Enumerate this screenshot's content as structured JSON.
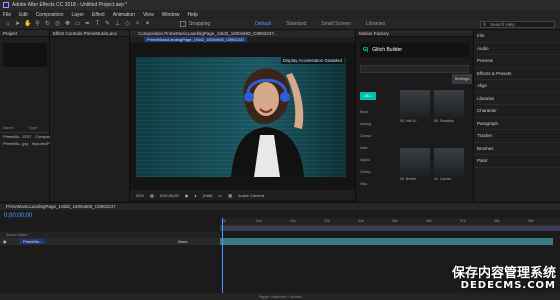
{
  "window": {
    "title": "Adobe After Effects CC 2018 - Untitled Project.aep *"
  },
  "menu": [
    "File",
    "Edit",
    "Composition",
    "Layer",
    "Effect",
    "Animation",
    "View",
    "Window",
    "Help"
  ],
  "toolbar": {
    "snapping": "Snapping",
    "workspaces": [
      "Default",
      "Standard",
      "Small Screen",
      "Libraries"
    ],
    "search_placeholder": "Search Help"
  },
  "project": {
    "tab": "Project",
    "columns": [
      "Name",
      "Type",
      "Size"
    ],
    "rows": [
      {
        "name": "PrimeMu...3707",
        "type": "Composition",
        "size": ""
      },
      {
        "name": "PrimeMu...jpg",
        "type": "ImporteJPG",
        "size": "2.5 KB"
      }
    ]
  },
  "effects_controls": {
    "tab": "Effect Controls PrimeMusicLanc"
  },
  "composition": {
    "tab": "Composition PrimeMusicLandingPage_1Sld2_1600x600_C8902247...",
    "sub_tab": "PrimeMusicLandingPage_1Sld2_1600x600_C8902247",
    "notice": "Display Acceleration Disabled",
    "zoom": "53%",
    "timecode": "0;00;00;00",
    "resolution": "(Half)",
    "camera": "Active Camera"
  },
  "motion_factory": {
    "tab": "Motion Factory",
    "product": "Glitch Builder",
    "all_label": "ALL",
    "categories": [
      "Basic",
      "Analog",
      "Classic",
      "Data",
      "Digital",
      "Glossy",
      "Misc"
    ],
    "presets": [
      "05. Hell N...",
      "06. Paradise",
      "09. Breath",
      "10. Carries"
    ],
    "settings_label": "Settings"
  },
  "right_panel": {
    "items": [
      "Info",
      "Audio",
      "Preview",
      "Effects & Presets",
      "Align",
      "Libraries",
      "Character",
      "Paragraph",
      "Tracker",
      "Brushes",
      "Paint"
    ]
  },
  "timeline": {
    "tab": "PrimeMusicLandingPage_1Sld2_1600x600_C8902247",
    "timecode": "0;00;00;00",
    "layer_header": "Source Name",
    "layer_name": "PrimeMu...",
    "mode": "None",
    "ruler_labels": [
      "0s",
      "01s",
      "02s",
      "03s",
      "04s",
      "05s",
      "06s",
      "07s",
      "08s",
      "09s"
    ],
    "footer": "Toggle Switches / Modes"
  },
  "watermark": {
    "line1": "保存内容管理系统",
    "line2": "DEDECMS.COM"
  },
  "colors": {
    "accent": "#4a9eff",
    "mf_accent": "#00c4a7",
    "fg_swatch": "#d01818"
  }
}
